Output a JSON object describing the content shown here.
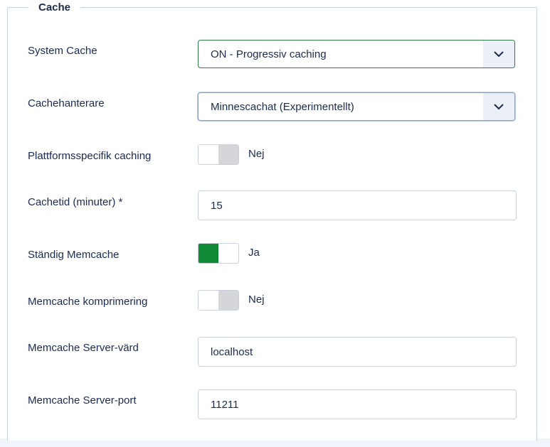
{
  "fieldset": {
    "legend": "Cache"
  },
  "fields": {
    "system_cache": {
      "label": "System Cache",
      "value": "ON - Progressiv caching"
    },
    "cache_handler": {
      "label": "Cachehanterare",
      "value": "Minnescachat (Experimentellt)"
    },
    "platform_caching": {
      "label": "Plattformsspecifik caching",
      "state": "Nej",
      "on": false
    },
    "cache_time": {
      "label": "Cachetid (minuter) *",
      "value": "15"
    },
    "persistent_memcache": {
      "label": "Ständig Memcache",
      "state": "Ja",
      "on": true
    },
    "memcache_compression": {
      "label": "Memcache komprimering",
      "state": "Nej",
      "on": false
    },
    "memcache_host": {
      "label": "Memcache Server-värd",
      "value": "localhost"
    },
    "memcache_port": {
      "label": "Memcache Server-port",
      "value": "11211"
    }
  },
  "colors": {
    "accent": "#108a35",
    "text": "#1c2b4a",
    "border": "#c9d1dc"
  }
}
